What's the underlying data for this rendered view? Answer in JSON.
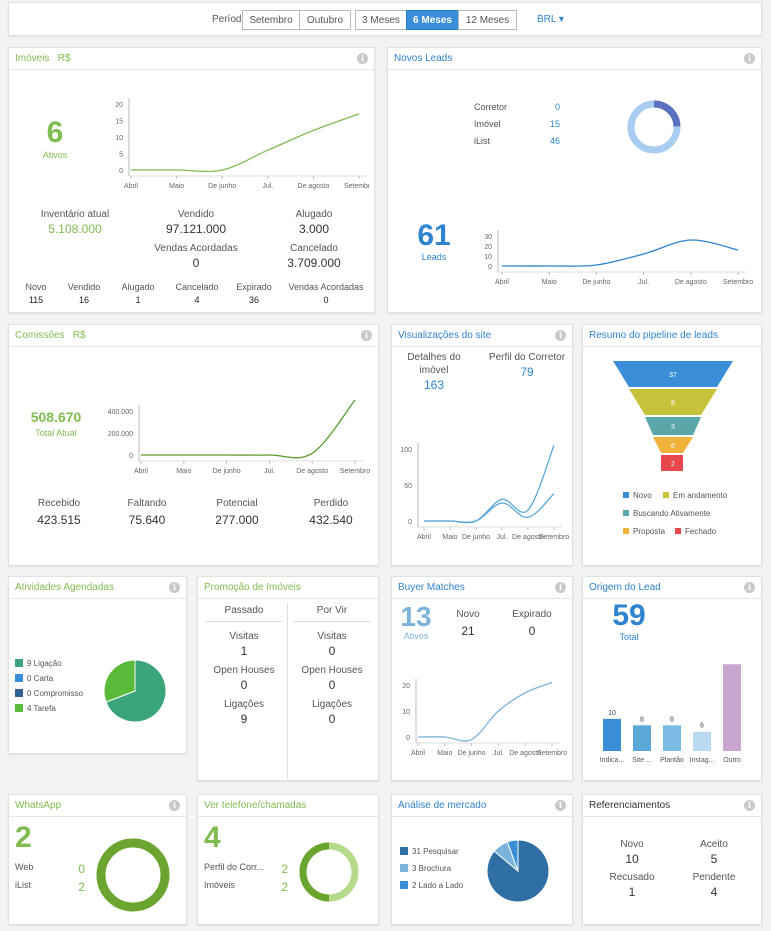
{
  "topbar": {
    "periodo_label": "Período:",
    "buttons": [
      "Setembro",
      "Outubro",
      "3 Meses",
      "6 Meses",
      "12 Meses"
    ],
    "active": "6 Meses",
    "currency": "BRL ▾"
  },
  "imoveis": {
    "title": "Imóveis",
    "title_suffix": "R$",
    "count": "6",
    "count_label": "Ativos",
    "chart_data": {
      "type": "line",
      "x": [
        "Abril",
        "Maio",
        "De junho",
        "Jul.",
        "De agosto",
        "Setembro"
      ],
      "yticks": [
        "20",
        "15",
        "10",
        "5",
        "0"
      ],
      "ylim": [
        0,
        20
      ],
      "series": [
        {
          "values": [
            0,
            0,
            0,
            6,
            12,
            17
          ]
        }
      ],
      "color": "#80bc52"
    },
    "stats": [
      {
        "label": "Inventário atual",
        "value": "5.108.000"
      },
      {
        "label": "Vendido",
        "value": "97.121.000"
      },
      {
        "label": "Alugado",
        "value": "3.000"
      },
      {
        "label": "Vendas Acordadas",
        "value": "0"
      },
      {
        "label": "Cancelado",
        "value": "3.709.000"
      }
    ],
    "bottom": [
      {
        "label": "Novo",
        "value": "115"
      },
      {
        "label": "Vendido",
        "value": "16"
      },
      {
        "label": "Alugado",
        "value": "1"
      },
      {
        "label": "Cancelado",
        "value": "4"
      },
      {
        "label": "Expirado",
        "value": "36"
      },
      {
        "label": "Vendas Acordadas",
        "value": "0"
      }
    ]
  },
  "novos_leads": {
    "title": "Novos Leads",
    "sources": [
      {
        "label": "Corretor",
        "value": "0"
      },
      {
        "label": "Imóvel",
        "value": "15"
      },
      {
        "label": "iList",
        "value": "46"
      }
    ],
    "donut_colors": [
      "#5a6fc0",
      "#a9cdf0"
    ],
    "count": "61",
    "count_label": "Leads",
    "chart_data": {
      "type": "line",
      "x": [
        "Abril",
        "Maio",
        "De junho",
        "Jul.",
        "De agosto",
        "Setembro"
      ],
      "yticks": [
        "30",
        "20",
        "10",
        "0"
      ],
      "ylim": [
        0,
        30
      ],
      "series": [
        {
          "values": [
            0,
            0,
            1,
            12,
            26,
            16
          ]
        }
      ],
      "color": "#2f84cf"
    }
  },
  "comissoes": {
    "title": "Comissões",
    "title_suffix": "R$",
    "total": "508.670",
    "total_label": "Total Atual",
    "chart_data": {
      "type": "line",
      "x": [
        "Abril",
        "Maio",
        "De junho",
        "Jul.",
        "De agosto",
        "Setembro"
      ],
      "yticks": [
        "400.000",
        "200.000",
        "0"
      ],
      "ylim": [
        0,
        400000
      ],
      "series": [
        {
          "values": [
            0,
            0,
            0,
            0,
            15000,
            500000
          ]
        }
      ],
      "color": "#5a9a2c"
    },
    "stats": [
      {
        "label": "Recebido",
        "value": "423.515"
      },
      {
        "label": "Faltando",
        "value": "75.640"
      },
      {
        "label": "Potencial",
        "value": "277.000"
      },
      {
        "label": "Perdido",
        "value": "432.540"
      }
    ]
  },
  "visualizacoes": {
    "title": "Visualizações do site",
    "stats": [
      {
        "label": "Detalhes do imóvel",
        "value": "163"
      },
      {
        "label": "Perfil do Corretor",
        "value": "79"
      }
    ],
    "chart_data": {
      "type": "line",
      "x": [
        "Abril",
        "Maio",
        "De junho",
        "Jul.",
        "De agosto",
        "Setembro"
      ],
      "yticks": [
        "100",
        "50",
        "0"
      ],
      "ylim": [
        0,
        100
      ],
      "series": [
        {
          "values": [
            0,
            0,
            0,
            30,
            15,
            105
          ]
        },
        {
          "values": [
            0,
            0,
            0,
            25,
            5,
            38
          ]
        }
      ],
      "color": "#5aa9d8"
    }
  },
  "pipeline": {
    "title": "Resumo do pipeline de leads",
    "chart_data": {
      "type": "bar",
      "categories": [
        "Novo",
        "Em andamento",
        "Buscando Ativamente",
        "Proposta",
        "Fechado"
      ],
      "values": [
        37,
        8,
        3,
        6,
        2
      ],
      "colors": [
        "#3a8ed8",
        "#c6c23a",
        "#5aa6a8",
        "#f1b23a",
        "#e8474c"
      ]
    }
  },
  "atividades": {
    "title": "Atividades Agendadas",
    "legend": [
      {
        "label": "9 Ligação",
        "color": "#3aa57a"
      },
      {
        "label": "0 Carta",
        "color": "#3a8ed8"
      },
      {
        "label": "0 Compromisso",
        "color": "#2f5f93"
      },
      {
        "label": "4 Tarefa",
        "color": "#5aba3a"
      }
    ],
    "pie_values": [
      9,
      0,
      0,
      4
    ]
  },
  "promocao": {
    "title": "Promoção de Imóveis",
    "columns": [
      {
        "header": "Passado",
        "rows": [
          {
            "label": "Visitas",
            "value": "1"
          },
          {
            "label": "Open Houses",
            "value": "0"
          },
          {
            "label": "Ligações",
            "value": "9"
          }
        ]
      },
      {
        "header": "Por Vir",
        "rows": [
          {
            "label": "Visitas",
            "value": "0"
          },
          {
            "label": "Open Houses",
            "value": "0"
          },
          {
            "label": "Ligações",
            "value": "0"
          }
        ]
      }
    ]
  },
  "buyer": {
    "title": "Buyer Matches",
    "count": "13",
    "count_label": "Ativos",
    "stats": [
      {
        "label": "Novo",
        "value": "21"
      },
      {
        "label": "Expirado",
        "value": "0"
      }
    ],
    "chart_data": {
      "type": "line",
      "x": [
        "Abril",
        "Maio",
        "De junho",
        "Jul.",
        "De agosto",
        "Setembro"
      ],
      "yticks": [
        "20",
        "10",
        "0"
      ],
      "ylim": [
        0,
        20
      ],
      "series": [
        {
          "values": [
            0,
            0,
            -1,
            10,
            17,
            21
          ]
        }
      ],
      "color": "#7bb3db"
    }
  },
  "origem": {
    "title": "Origem do Lead",
    "count": "59",
    "count_label": "Total",
    "chart_data": {
      "type": "bar",
      "categories": [
        "Indica...",
        "Site ...",
        "Plantão",
        "Instag...",
        "Outro"
      ],
      "values": [
        10,
        8,
        8,
        6,
        27
      ],
      "colors": [
        "#3a8ed8",
        "#5aa9d8",
        "#7bbbe3",
        "#b9daf0",
        "#c9a6cf"
      ]
    }
  },
  "whatsapp": {
    "title": "WhatsApp",
    "count": "2",
    "rows": [
      {
        "label": "Web",
        "value": "0"
      },
      {
        "label": "iList",
        "value": "2"
      }
    ],
    "ring_color": "#6ba52f",
    "ring_fraction": 1
  },
  "telefone": {
    "title": "Ver telefone/chamadas",
    "count": "4",
    "rows": [
      {
        "label": "Perfil do Corr...",
        "value": "2"
      },
      {
        "label": "Imóveis",
        "value": "2"
      }
    ],
    "ring_colors": [
      "#6ba52f",
      "#b6d98a"
    ],
    "ring_fraction": 0.5
  },
  "mercado": {
    "title": "Análise de mercado",
    "legend": [
      {
        "label": "31 Pesquisar",
        "color": "#2f6fa3"
      },
      {
        "label": "3 Brochura",
        "color": "#7bb3db"
      },
      {
        "label": "2 Lado a Lado",
        "color": "#3a8ed8"
      }
    ],
    "pie_values": [
      31,
      3,
      2
    ]
  },
  "referenciamentos": {
    "title": "Referenciamentos",
    "stats": [
      {
        "label": "Novo",
        "value": "10"
      },
      {
        "label": "Aceito",
        "value": "5"
      },
      {
        "label": "Recusado",
        "value": "1"
      },
      {
        "label": "Pendente",
        "value": "4"
      }
    ]
  }
}
